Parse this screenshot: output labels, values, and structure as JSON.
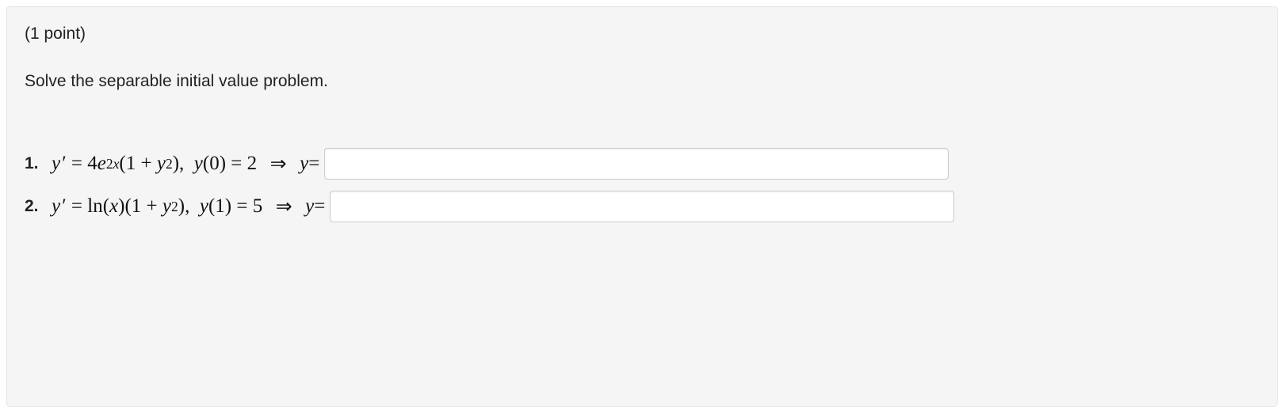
{
  "header": {
    "points_label": "(1 point)"
  },
  "instructions": "Solve the separable initial value problem.",
  "problems": [
    {
      "number": "1.",
      "equation_html": "<span class='it'>y</span>&#8202;&#8242;&nbsp;=&nbsp;4<span class='it'>e</span><sup>2<span class='it'>x</span></sup>(1&nbsp;+&nbsp;<span class='it'>y</span><sup>2</sup>),&nbsp;&nbsp;<span class='it'>y</span>(0)&nbsp;=&nbsp;2&nbsp;&nbsp;<span class='arrow'>&rArr;</span>&nbsp;&nbsp;<span class='it'>y</span>=",
      "answer_value": ""
    },
    {
      "number": "2.",
      "equation_html": "<span class='it'>y</span>&#8202;&#8242;&nbsp;=&nbsp;ln(<span class='it'>x</span>)(1&nbsp;+&nbsp;<span class='it'>y</span><sup>2</sup>),&nbsp;&nbsp;<span class='it'>y</span>(1)&nbsp;=&nbsp;5&nbsp;&nbsp;<span class='arrow'>&rArr;</span>&nbsp;&nbsp;<span class='it'>y</span>=",
      "answer_value": ""
    }
  ]
}
